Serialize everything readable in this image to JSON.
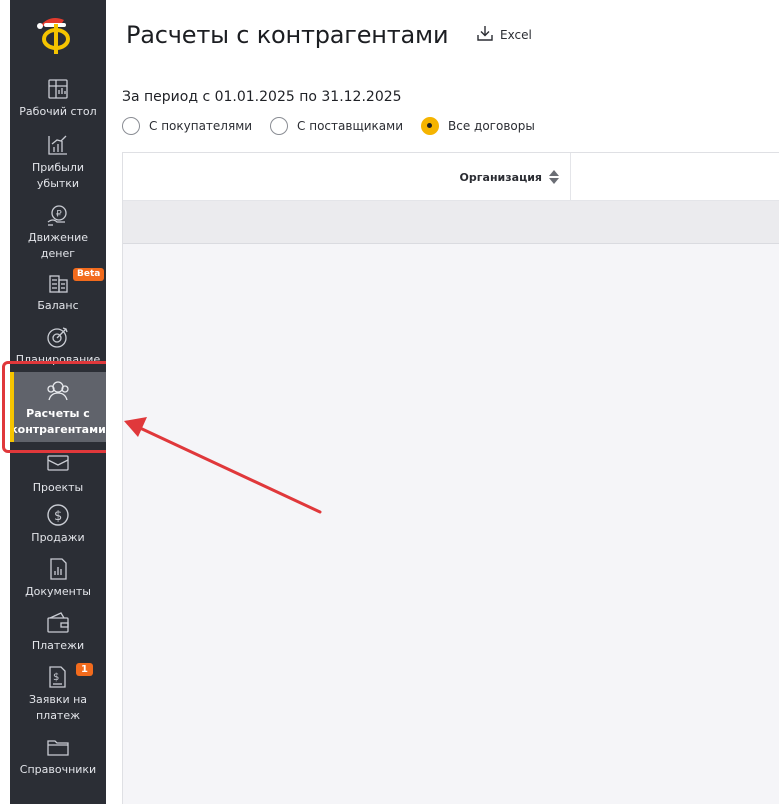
{
  "sidebar": {
    "items": [
      {
        "label": "Рабочий стол",
        "icon": "desktop-icon"
      },
      {
        "label": "Прибыли\nубытки",
        "icon": "bar-chart-icon"
      },
      {
        "label": "Движение\nденег",
        "icon": "money-flow-icon"
      },
      {
        "label": "Баланс",
        "icon": "balance-icon",
        "badge": "Beta"
      },
      {
        "label": "Планирование",
        "icon": "target-icon"
      },
      {
        "label": "Расчеты с\nконтрагентами",
        "icon": "counterparties-icon",
        "active": true
      },
      {
        "label": "Проекты",
        "icon": "briefcase-icon"
      },
      {
        "label": "Продажи",
        "icon": "dollar-circle-icon"
      },
      {
        "label": "Документы",
        "icon": "document-chart-icon"
      },
      {
        "label": "Платежи",
        "icon": "wallet-icon"
      },
      {
        "label": "Заявки на\nплатеж",
        "icon": "payment-request-icon",
        "badge": "1"
      },
      {
        "label": "Справочники",
        "icon": "folder-icon"
      }
    ]
  },
  "header": {
    "title": "Расчеты с контрагентами",
    "excel_label": "Excel"
  },
  "filters": {
    "period": "За период с 01.01.2025 по 31.12.2025",
    "options": [
      {
        "label": "С покупателями",
        "checked": false
      },
      {
        "label": "С поставщиками",
        "checked": false
      },
      {
        "label": "Все договоры",
        "checked": true
      }
    ]
  },
  "table": {
    "columns": [
      "Организация"
    ]
  },
  "colors": {
    "sidebar_bg": "#2b2e35",
    "accent": "#f5c400",
    "highlight": "#e0383b",
    "badge": "#f26b1d"
  }
}
